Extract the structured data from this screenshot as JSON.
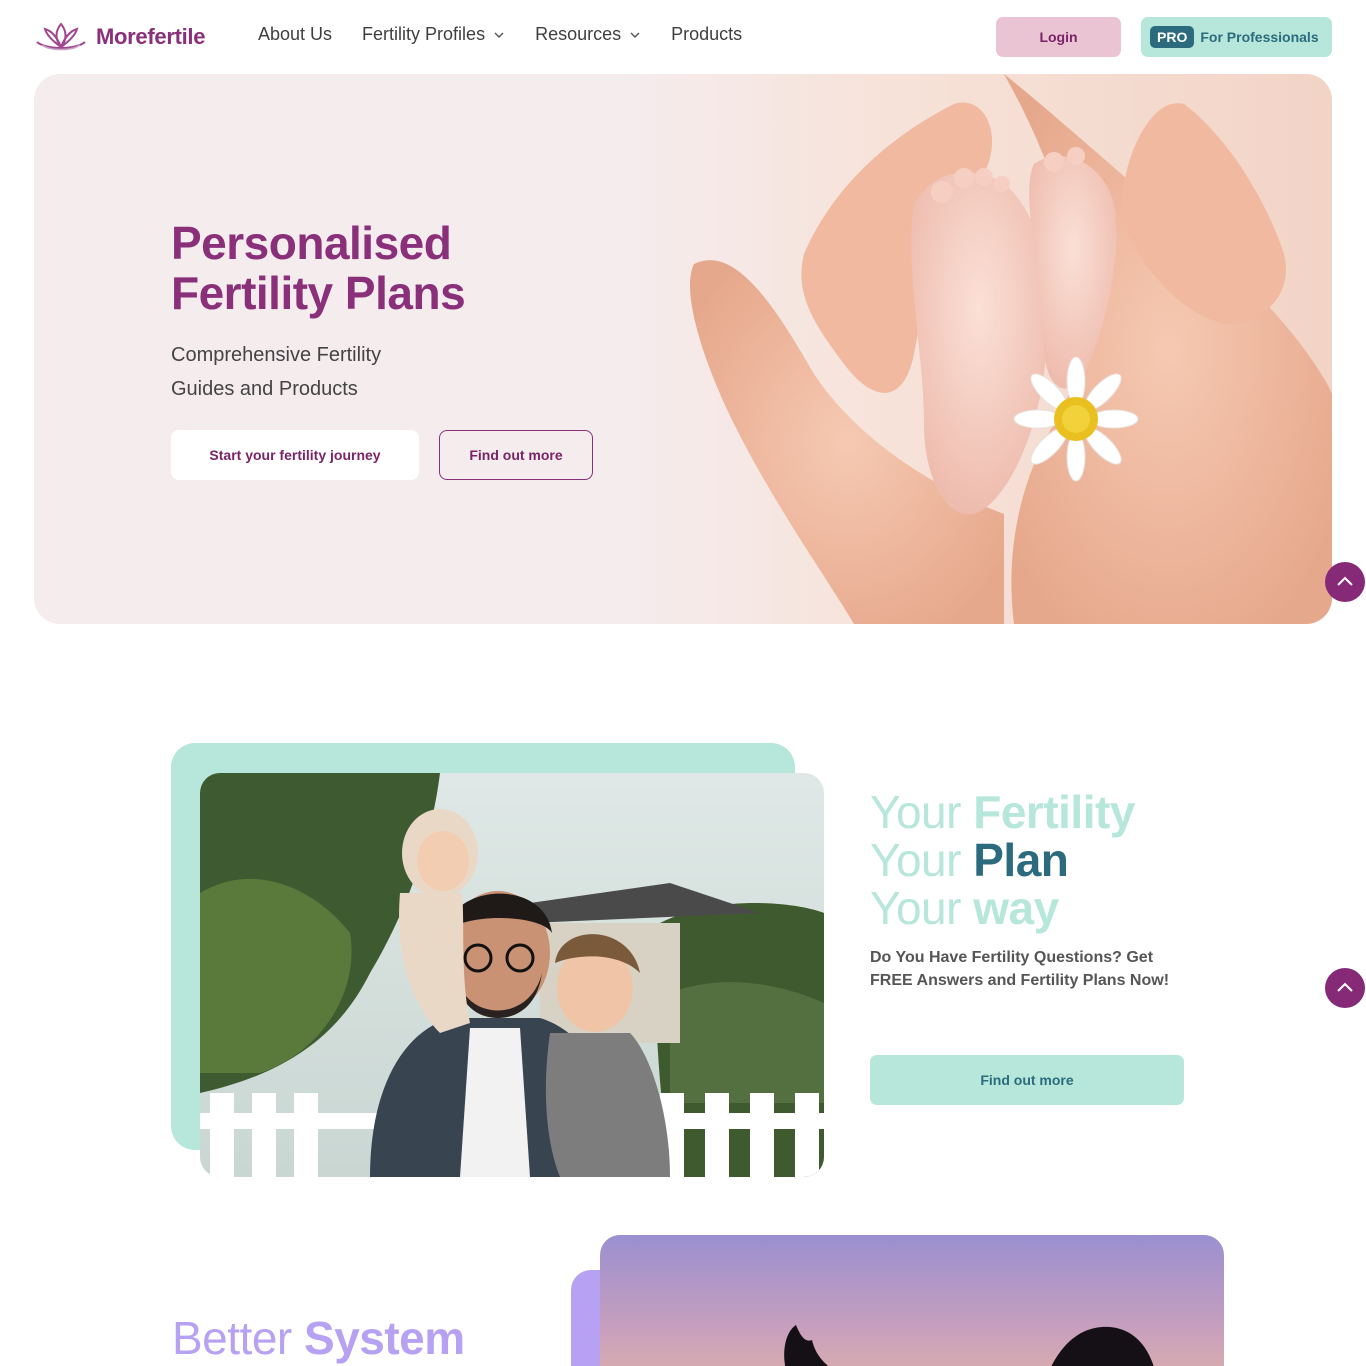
{
  "brand": {
    "name": "Morefertile",
    "logo_icon": "lotus-icon",
    "color": "#8a2f7a"
  },
  "nav": {
    "items": [
      {
        "label": "About Us",
        "has_dropdown": false
      },
      {
        "label": "Fertility Profiles",
        "has_dropdown": true
      },
      {
        "label": "Resources",
        "has_dropdown": true
      },
      {
        "label": "Products",
        "has_dropdown": false
      }
    ],
    "login_label": "Login",
    "pro_badge": "PRO",
    "pro_label": "For Professionals"
  },
  "hero": {
    "title_line1": "Personalised",
    "title_line2": "Fertility Plans",
    "subtitle_line1": "Comprehensive Fertility",
    "subtitle_line2": "Guides and Products",
    "primary_cta": "Start your fertility journey",
    "secondary_cta": "Find out more"
  },
  "section2": {
    "line1_light": "Your",
    "line1_bold": "Fertility",
    "line2_light": "Your",
    "line2_bold": "Plan",
    "line3_light": "Your",
    "line3_bold": "way",
    "subtitle": "Do You Have Fertility Questions? Get FREE Answers and Fertility Plans Now!",
    "cta": "Find out more"
  },
  "section3": {
    "heading_light": "Better",
    "heading_bold": "System"
  },
  "colors": {
    "brand_purple": "#8a2f7a",
    "mint": "#b6e7da",
    "teal": "#2c6b7e",
    "pink": "#ebc4d3",
    "lavender": "#b7a1f2",
    "hero_bg": "#f5ecee"
  }
}
